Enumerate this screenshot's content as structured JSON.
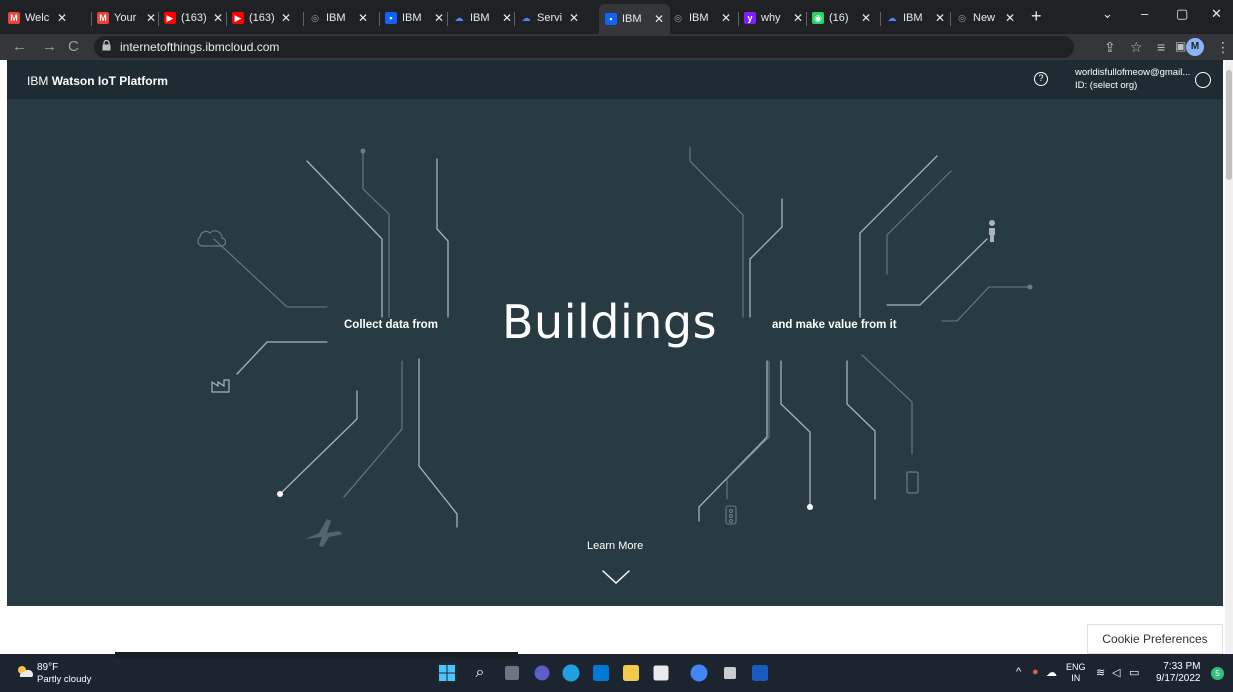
{
  "browser": {
    "tabs": [
      {
        "title": "Welc",
        "icon": "gmail-icon",
        "color": "#ea4335",
        "fav": "M"
      },
      {
        "title": "Your",
        "icon": "gmail-icon",
        "color": "#ea4335",
        "fav": "M"
      },
      {
        "title": "(163)",
        "icon": "youtube-icon",
        "color": "#ff0000",
        "fav": "▶"
      },
      {
        "title": "(163)",
        "icon": "youtube-icon",
        "color": "#ff0000",
        "fav": "▶"
      },
      {
        "title": "IBM",
        "icon": "globe-icon",
        "color": "#9aa0a6",
        "fav": "◎"
      },
      {
        "title": "IBM",
        "icon": "ibm-iot-icon",
        "color": "#0f62fe",
        "fav": "▪"
      },
      {
        "title": "IBM",
        "icon": "ibm-cloud-icon",
        "color": "#4589ff",
        "fav": "☁"
      },
      {
        "title": "Servi",
        "icon": "ibm-cloud-icon",
        "color": "#4589ff",
        "fav": "☁"
      },
      {
        "title": "IBM",
        "icon": "ibm-iot-icon",
        "color": "#0f62fe",
        "fav": "▪"
      },
      {
        "title": "IBM",
        "icon": "globe-icon",
        "color": "#9aa0a6",
        "fav": "◎"
      },
      {
        "title": "why",
        "icon": "yahoo-icon",
        "color": "#7e1fff",
        "fav": "y"
      },
      {
        "title": "(16)",
        "icon": "whatsapp-icon",
        "color": "#25d366",
        "fav": "◉"
      },
      {
        "title": "IBM",
        "icon": "ibm-cloud-icon",
        "color": "#4589ff",
        "fav": "☁"
      },
      {
        "title": "New",
        "icon": "globe-icon",
        "color": "#9aa0a6",
        "fav": "◎"
      }
    ],
    "url": "internetofthings.ibmcloud.com",
    "profile_initial": "M"
  },
  "iot": {
    "brand_prefix": "IBM",
    "brand_name": "Watson IoT Platform",
    "account_email": "worldisfullofmeow@gmail...",
    "account_org": "ID: (select org)",
    "hero_left": "Collect data from",
    "hero_word": "Buildings",
    "hero_right": "and make value from it",
    "learn_more": "Learn More",
    "cookie": "Cookie Preferences"
  },
  "taskbar": {
    "temp": "89°F",
    "condition": "Partly cloudy",
    "lang_top": "ENG",
    "lang_bottom": "IN",
    "time": "7:33 PM",
    "date": "9/17/2022",
    "notifications": "5"
  }
}
